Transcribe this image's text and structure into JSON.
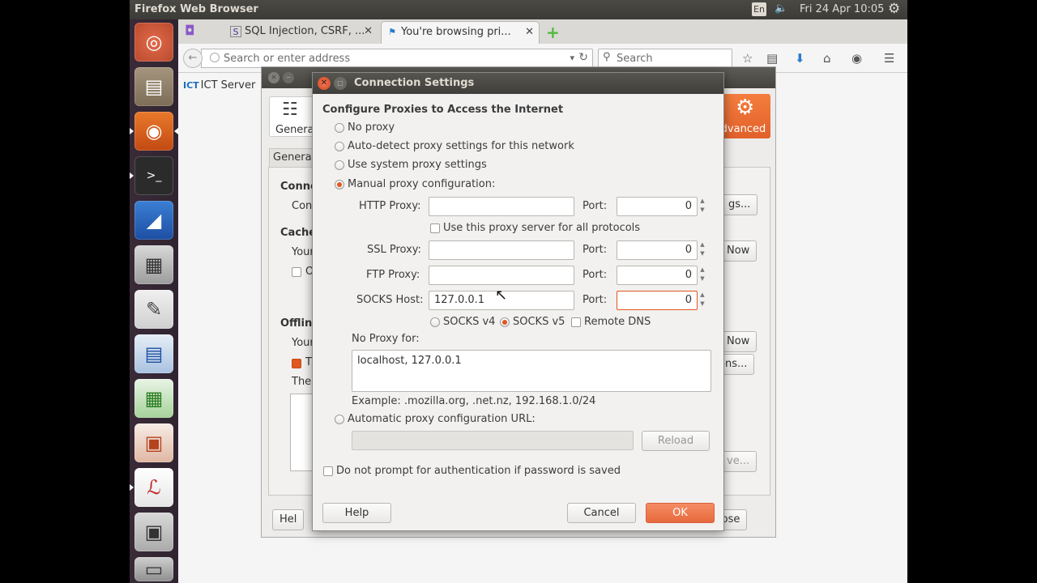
{
  "top_panel": {
    "app_title": "Firefox Web Browser",
    "keyboard_layout": "En",
    "datetime": "Fri 24 Apr 10:05"
  },
  "browser": {
    "tabs": [
      {
        "label": "SQL Injection, CSRF, ...",
        "favicon": "S"
      },
      {
        "label": "You're browsing pri...",
        "favicon": "flag"
      }
    ],
    "url_placeholder": "Search or enter address",
    "search_placeholder": "Search",
    "bookmark_label": "ICT Server",
    "bookmark_prefix": "ICT"
  },
  "preferences": {
    "general_tab": "General",
    "advanced_tab": "Advanced",
    "subtab": "General",
    "connection_heading": "Conne",
    "connection_text": "Con",
    "settings_btn": "gs...",
    "cache_heading": "Cache",
    "cache_text": "Your",
    "clear_now_btn_1": "Now",
    "override_label": "O",
    "offline_heading": "Offlin",
    "offline_text": "Your",
    "clear_now_btn_2": "Now",
    "tell_label": "T",
    "exceptions_btn": "ons...",
    "the_text": "The",
    "remove_btn": "ve...",
    "help_btn": "Hel",
    "close_btn": "lose"
  },
  "connection_settings": {
    "title": "Connection Settings",
    "heading": "Configure Proxies to Access the Internet",
    "options": {
      "no_proxy": "No proxy",
      "auto_detect": "Auto-detect proxy settings for this network",
      "system": "Use system proxy settings",
      "manual": "Manual proxy configuration:"
    },
    "http_label": "HTTP Proxy:",
    "http_value": "",
    "http_port": "0",
    "use_all_label": "Use this proxy server for all protocols",
    "ssl_label": "SSL Proxy:",
    "ssl_value": "",
    "ssl_port": "0",
    "ftp_label": "FTP Proxy:",
    "ftp_value": "",
    "ftp_port": "0",
    "socks_label": "SOCKS Host:",
    "socks_value": "127.0.0.1",
    "socks_port": "0",
    "port_label": "Port:",
    "socks_v4": "SOCKS v4",
    "socks_v5": "SOCKS v5",
    "remote_dns": "Remote DNS",
    "no_proxy_label": "No Proxy for:",
    "no_proxy_value": "localhost, 127.0.0.1",
    "example": "Example: .mozilla.org, .net.nz, 192.168.1.0/24",
    "auto_url_label": "Automatic proxy configuration URL:",
    "reload_btn": "Reload",
    "no_prompt_label": "Do not prompt for authentication if password is saved",
    "help_btn": "Help",
    "cancel_btn": "Cancel",
    "ok_btn": "OK"
  },
  "colors": {
    "accent": "#e0571f",
    "panel": "#3c3b37",
    "launcher": "#2f2430"
  }
}
